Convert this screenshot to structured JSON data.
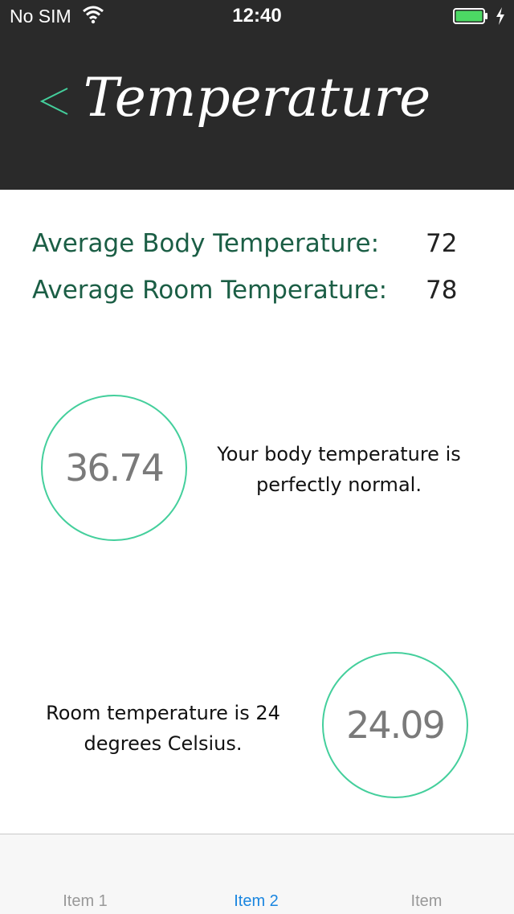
{
  "status_bar": {
    "carrier": "No SIM",
    "time": "12:40"
  },
  "nav": {
    "title": "Temperature",
    "back_icon": "chevron-left-icon"
  },
  "stats": {
    "body_label": "Average Body Temperature:",
    "body_value": "72",
    "room_label": "Average Room Temperature:",
    "room_value": "78"
  },
  "body_reading": {
    "value": "36.74",
    "message_line1": "Your body temperature is",
    "message_line2": "perfectly normal."
  },
  "room_reading": {
    "value": "24.09",
    "message_line1": "Room temperature is 24",
    "message_line2": "degrees Celsius."
  },
  "tabs": [
    {
      "label": "Item 1",
      "active": false
    },
    {
      "label": "Item 2",
      "active": true
    },
    {
      "label": "Item",
      "active": false
    }
  ],
  "colors": {
    "nav_background": "#2a2a2a",
    "accent_green": "#44cf9c",
    "label_green": "#1b5e45",
    "battery_green": "#4cd964",
    "tab_active": "#1a86e0"
  }
}
